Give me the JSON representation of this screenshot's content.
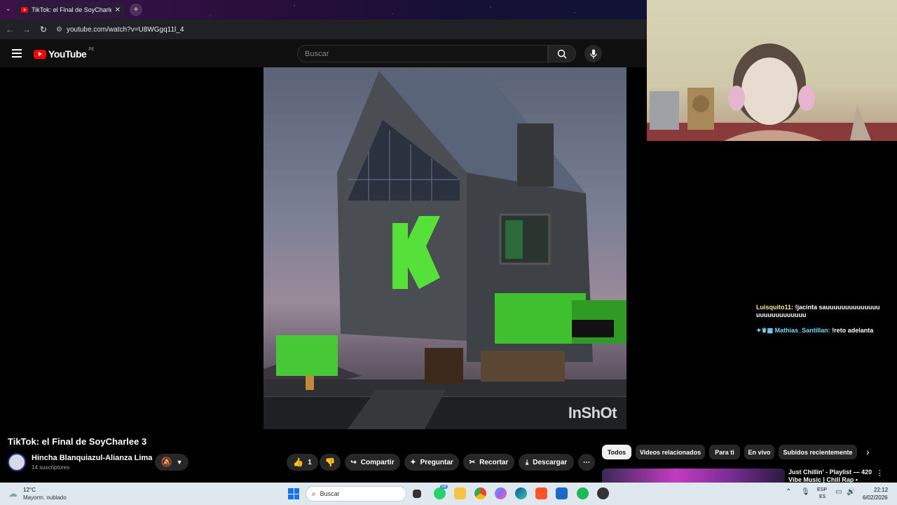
{
  "browser": {
    "tab_title": "TikTok: el Final de SoyCharlee 3",
    "url": "youtube.com/watch?v=U8WGgq11l_4"
  },
  "youtube": {
    "logo": "YouTube",
    "country_code": "PE",
    "search_placeholder": "Buscar"
  },
  "video": {
    "watermark": "InShOt",
    "title": "TikTok: el Final de SoyCharlee 3",
    "channel": "Hincha Blanquiazul-Alianza Lima",
    "subscribers": "14 suscriptores",
    "likes": "1",
    "actions": {
      "share": "Compartir",
      "ask": "Preguntar",
      "clip": "Recortar",
      "download": "Descargar"
    }
  },
  "chat": [
    {
      "user": "Luisquito11:",
      "text": "!jacinta sauuuuuuuuuuuuuuuuuuuuuuuuuuu"
    },
    {
      "user": "Mathias_Santillan:",
      "text": "!reto adelanta"
    }
  ],
  "filters": [
    "Todos",
    "Videos relacionados",
    "Para ti",
    "En vivo",
    "Subidos recientemente"
  ],
  "recommended": {
    "title": "Just Chillin' - Playlist — 420 Vibe Music | Chill Rap •"
  },
  "taskbar": {
    "temperature": "12°C",
    "weather": "Mayorm. nublado",
    "search": "Buscar",
    "lang_line1": "ESP",
    "lang_line2": "ES",
    "time": "22:12",
    "date": "6/02/2026",
    "whatsapp_badge": "58"
  },
  "colors": {
    "accent": "#ff0000",
    "led_green": "#55e03a",
    "chat_name": "#f3e9a0",
    "chat_name2": "#7fd7ff"
  }
}
